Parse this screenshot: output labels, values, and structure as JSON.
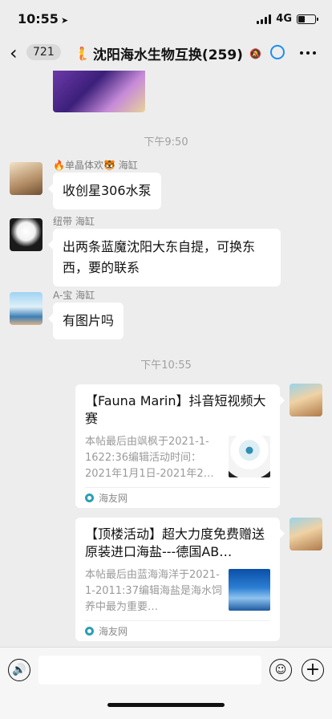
{
  "status_bar": {
    "time": "10:55",
    "location_glyph": "➤",
    "network": "4G"
  },
  "nav": {
    "back_glyph": "‹",
    "unread_count": "721",
    "title": "沈阳海水生物互换(259)",
    "mermaid_glyph": "🧜",
    "mute_glyph": "🔕",
    "more_icon": "more-icon"
  },
  "chat": {
    "timestamps": [
      "下午9:50",
      "下午10:55"
    ],
    "messages": [
      {
        "sender": "🔥单晶体欢🐯 海缸",
        "text": "收创星306水泵"
      },
      {
        "sender": "纽带 海缸",
        "text": "出两条蓝魔沈阳大东自提，可换东西，要的联系"
      },
      {
        "sender": "A-宝 海缸",
        "text": "有图片吗"
      }
    ],
    "cards": [
      {
        "title": "【Fauna Marin】抖音短视频大赛",
        "desc": "本帖最后由飒枫于2021-1-1622:36编辑活动时间：2021年1月1日-2021年2…",
        "source": "海友网"
      },
      {
        "title": "【顶楼活动】超大力度免费赠送原装进口海盐---德国AB…",
        "desc": "本帖最后由蓝海海洋于2021-1-2011:37编辑海盐是海水饲养中最为重要…",
        "source": "海友网"
      }
    ]
  },
  "input_bar": {
    "voice_glyph": "🔊",
    "emoji_glyph": "☺",
    "plus_glyph": "+"
  },
  "colors": {
    "background": "#ededed",
    "accent_ring": "#1e8ef0",
    "bubble": "#ffffff"
  }
}
